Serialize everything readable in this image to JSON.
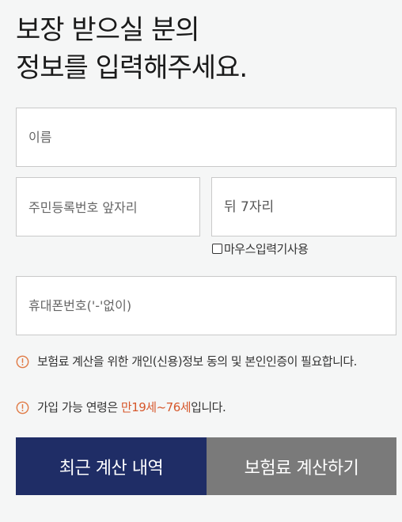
{
  "heading": {
    "line1": "보장 받으실 분의",
    "line2": "정보를 입력해주세요."
  },
  "form": {
    "name_placeholder": "이름",
    "rrn_front_placeholder": "주민등록번호 앞자리",
    "rrn_back_placeholder": "뒤 7자리",
    "mouse_input_label": "마우스입력기사용",
    "phone_placeholder": "휴대폰번호('-'없이)"
  },
  "notices": {
    "consent": "보험료 계산을 위한 개인(신용)정보 동의 및 본인인증이 필요합니다.",
    "age_prefix": "가입 가능 연령은 ",
    "age_highlight": "만19세~76세",
    "age_suffix": "입니다."
  },
  "buttons": {
    "recent": "최근 계산 내역",
    "calculate": "보험료 계산하기"
  },
  "colors": {
    "primary_button": "#1f2d66",
    "secondary_button": "#7a7a7a",
    "highlight": "#d6572b",
    "warning_icon": "#e07a45"
  },
  "icons": {
    "warning": "exclamation-circle-icon",
    "checkbox": "checkbox-icon"
  }
}
